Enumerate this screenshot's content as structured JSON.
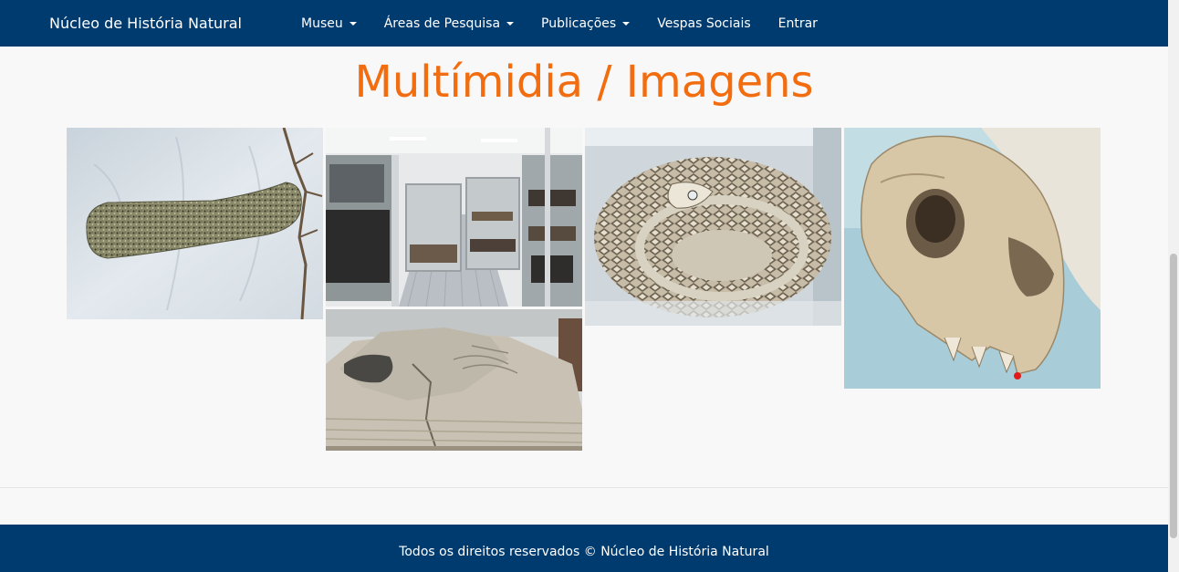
{
  "navbar": {
    "brand": "Núcleo de História Natural",
    "items": [
      {
        "label": "Museu",
        "dropdown": true
      },
      {
        "label": "Áreas de Pesquisa",
        "dropdown": true
      },
      {
        "label": "Publicações",
        "dropdown": true
      },
      {
        "label": "Vespas Sociais",
        "dropdown": false
      },
      {
        "label": "Entrar",
        "dropdown": false
      }
    ]
  },
  "main": {
    "title": "Multímidia / Imagens"
  },
  "footer": {
    "text": "Todos os direitos reservados © Núcleo de História Natural"
  },
  "colors": {
    "navbar": "#003b6f",
    "title": "#f26d0f",
    "page_background": "#f8f8f9"
  }
}
